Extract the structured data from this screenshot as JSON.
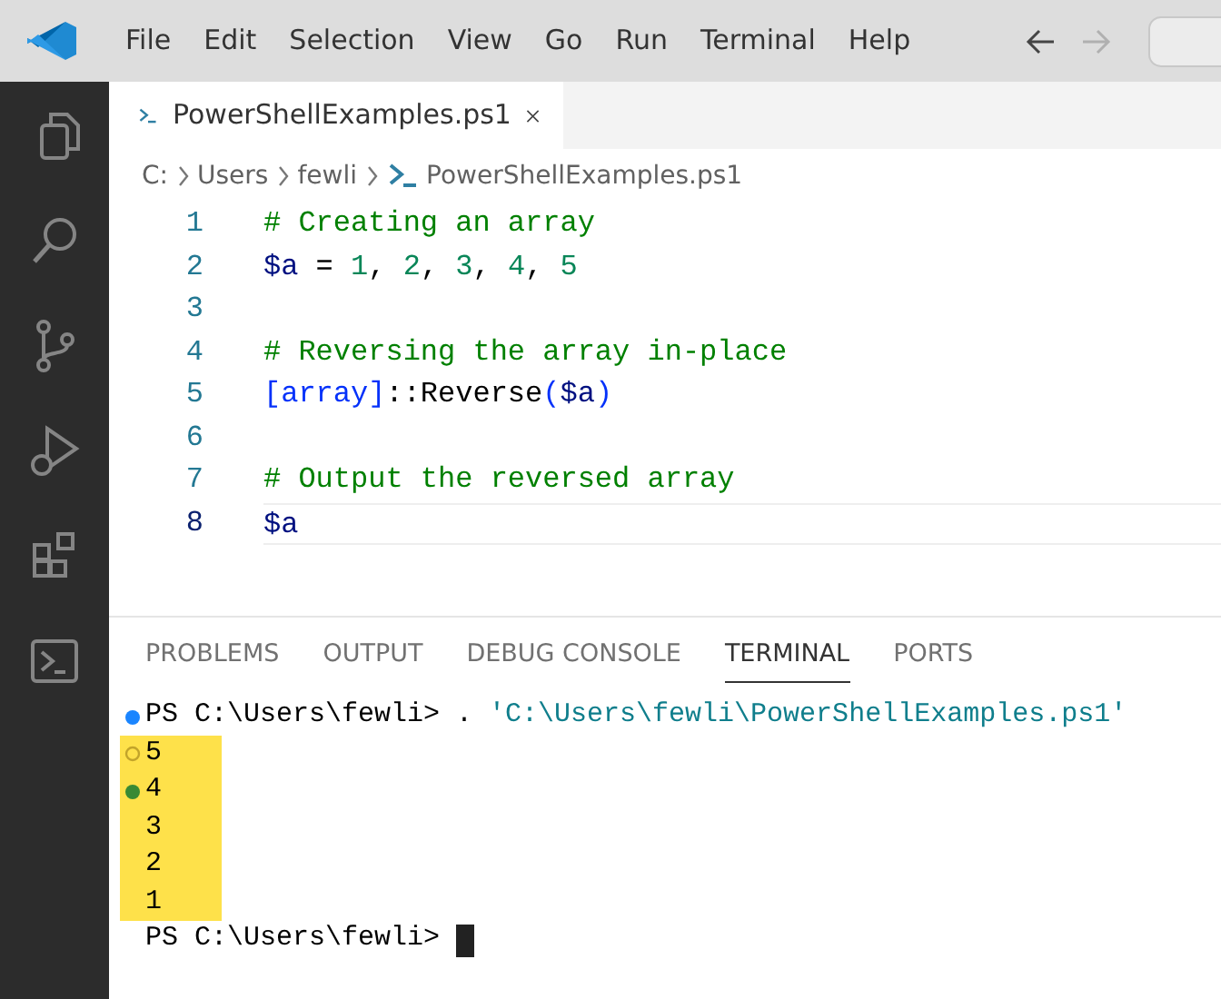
{
  "menu": [
    "File",
    "Edit",
    "Selection",
    "View",
    "Go",
    "Run",
    "Terminal",
    "Help"
  ],
  "nav": [
    {
      "kind": "back",
      "disabled": false
    },
    {
      "kind": "forward",
      "disabled": true
    }
  ],
  "activity_bar": [
    {
      "kind": "files"
    },
    {
      "kind": "search"
    },
    {
      "kind": "source-control"
    },
    {
      "kind": "run-debug"
    },
    {
      "kind": "extensions"
    },
    {
      "kind": "terminal"
    }
  ],
  "editor_tabs": [
    {
      "label": "PowerShellExamples.ps1",
      "selected": true
    }
  ],
  "breadcrumb": [
    {
      "label": "C:",
      "kind": "folder"
    },
    {
      "label": "Users",
      "kind": "folder"
    },
    {
      "label": "fewli",
      "kind": "folder"
    },
    {
      "label": "PowerShellExamples.ps1",
      "kind": "file"
    }
  ],
  "code_lines": [
    {
      "number": "1",
      "current": false,
      "tokens": [
        {
          "text": "# Creating an array",
          "kind": "comment"
        }
      ]
    },
    {
      "number": "2",
      "current": false,
      "tokens": [
        {
          "text": "$a",
          "kind": "var"
        },
        {
          "text": " = ",
          "kind": "plain"
        },
        {
          "text": "1",
          "kind": "num"
        },
        {
          "text": ", ",
          "kind": "plain"
        },
        {
          "text": "2",
          "kind": "num"
        },
        {
          "text": ", ",
          "kind": "plain"
        },
        {
          "text": "3",
          "kind": "num"
        },
        {
          "text": ", ",
          "kind": "plain"
        },
        {
          "text": "4",
          "kind": "num"
        },
        {
          "text": ", ",
          "kind": "plain"
        },
        {
          "text": "5",
          "kind": "num"
        }
      ]
    },
    {
      "number": "3",
      "current": false
    },
    {
      "number": "4",
      "current": false,
      "tokens": [
        {
          "text": "# Reversing the array in-place",
          "kind": "comment"
        }
      ]
    },
    {
      "number": "5",
      "current": false,
      "tokens": [
        {
          "text": "[array]",
          "kind": "type"
        },
        {
          "text": "::Reverse",
          "kind": "plain"
        },
        {
          "text": "(",
          "kind": "type"
        },
        {
          "text": "$a",
          "kind": "var"
        },
        {
          "text": ")",
          "kind": "type"
        }
      ]
    },
    {
      "number": "6",
      "current": false
    },
    {
      "number": "7",
      "current": false,
      "tokens": [
        {
          "text": "# Output the reversed array",
          "kind": "comment"
        }
      ]
    },
    {
      "number": "8",
      "current": true,
      "tokens": [
        {
          "text": "$a",
          "kind": "var"
        }
      ]
    }
  ],
  "panel_tabs": [
    {
      "label": "PROBLEMS",
      "selected": false
    },
    {
      "label": "OUTPUT",
      "selected": false
    },
    {
      "label": "DEBUG CONSOLE",
      "selected": false
    },
    {
      "label": "TERMINAL",
      "selected": true
    },
    {
      "label": "PORTS",
      "selected": false
    }
  ],
  "terminal_lines": [
    {
      "kind": "running",
      "highlighted": false,
      "tokens": [
        {
          "text": "PS C:\\Users\\fewli> . ",
          "kind": "plain"
        },
        {
          "text": "'C:\\Users\\fewli\\PowerShellExamples.ps1'",
          "kind": "string"
        }
      ]
    },
    {
      "kind": "hollow",
      "highlighted": true,
      "tokens": [
        {
          "text": "5",
          "kind": "plain"
        }
      ]
    },
    {
      "kind": "success",
      "highlighted": true,
      "tokens": [
        {
          "text": "4",
          "kind": "plain"
        }
      ]
    },
    {
      "kind": "plain",
      "highlighted": true,
      "tokens": [
        {
          "text": "3",
          "kind": "plain"
        }
      ]
    },
    {
      "kind": "plain",
      "highlighted": true,
      "tokens": [
        {
          "text": "2",
          "kind": "plain"
        }
      ]
    },
    {
      "kind": "plain",
      "highlighted": true,
      "tokens": [
        {
          "text": "1",
          "kind": "plain"
        }
      ]
    },
    {
      "kind": "plain",
      "highlighted": false,
      "cursor": true,
      "tokens": [
        {
          "text": "PS C:\\Users\\fewli> ",
          "kind": "plain"
        }
      ]
    }
  ]
}
